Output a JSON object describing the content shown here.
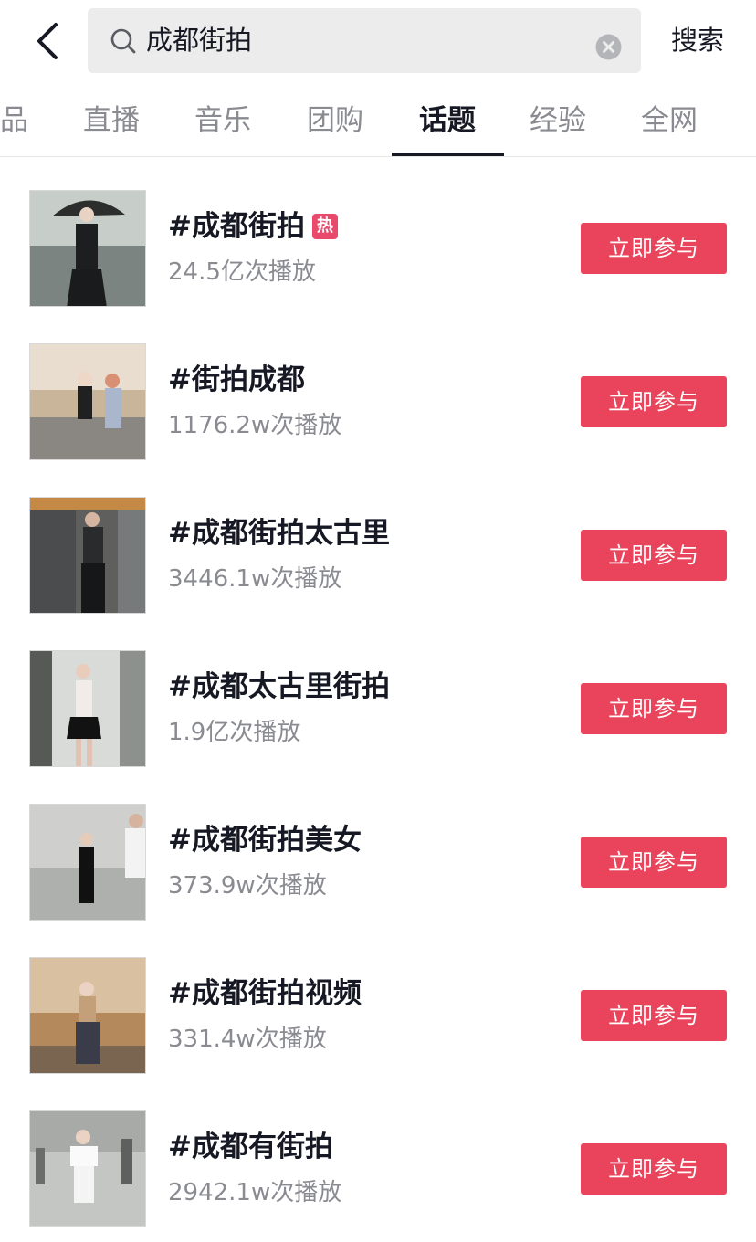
{
  "header": {
    "back_icon": "chevron-left-icon",
    "search_icon": "search-icon",
    "search_value": "成都街拍",
    "clear_icon": "clear-icon",
    "search_label": "搜索"
  },
  "tabs": [
    {
      "label": "品",
      "active": false
    },
    {
      "label": "直播",
      "active": false
    },
    {
      "label": "音乐",
      "active": false
    },
    {
      "label": "团购",
      "active": false
    },
    {
      "label": "话题",
      "active": true
    },
    {
      "label": "经验",
      "active": false
    },
    {
      "label": "全网",
      "active": false
    }
  ],
  "topics": [
    {
      "title": "#成都街拍",
      "badge": "热",
      "plays": "24.5亿次播放",
      "button": "立即参与"
    },
    {
      "title": "#街拍成都",
      "badge": "",
      "plays": "1176.2w次播放",
      "button": "立即参与"
    },
    {
      "title": "#成都街拍太古里",
      "badge": "",
      "plays": "3446.1w次播放",
      "button": "立即参与"
    },
    {
      "title": "#成都太古里街拍",
      "badge": "",
      "plays": "1.9亿次播放",
      "button": "立即参与"
    },
    {
      "title": "#成都街拍美女",
      "badge": "",
      "plays": "373.9w次播放",
      "button": "立即参与"
    },
    {
      "title": "#成都街拍视频",
      "badge": "",
      "plays": "331.4w次播放",
      "button": "立即参与"
    },
    {
      "title": "#成都有街拍",
      "badge": "",
      "plays": "2942.1w次播放",
      "button": "立即参与"
    }
  ],
  "colors": {
    "accent": "#e9445b",
    "hot_badge": "#e94a6b",
    "muted_text": "#8a8b91",
    "search_bg": "#ececec"
  }
}
